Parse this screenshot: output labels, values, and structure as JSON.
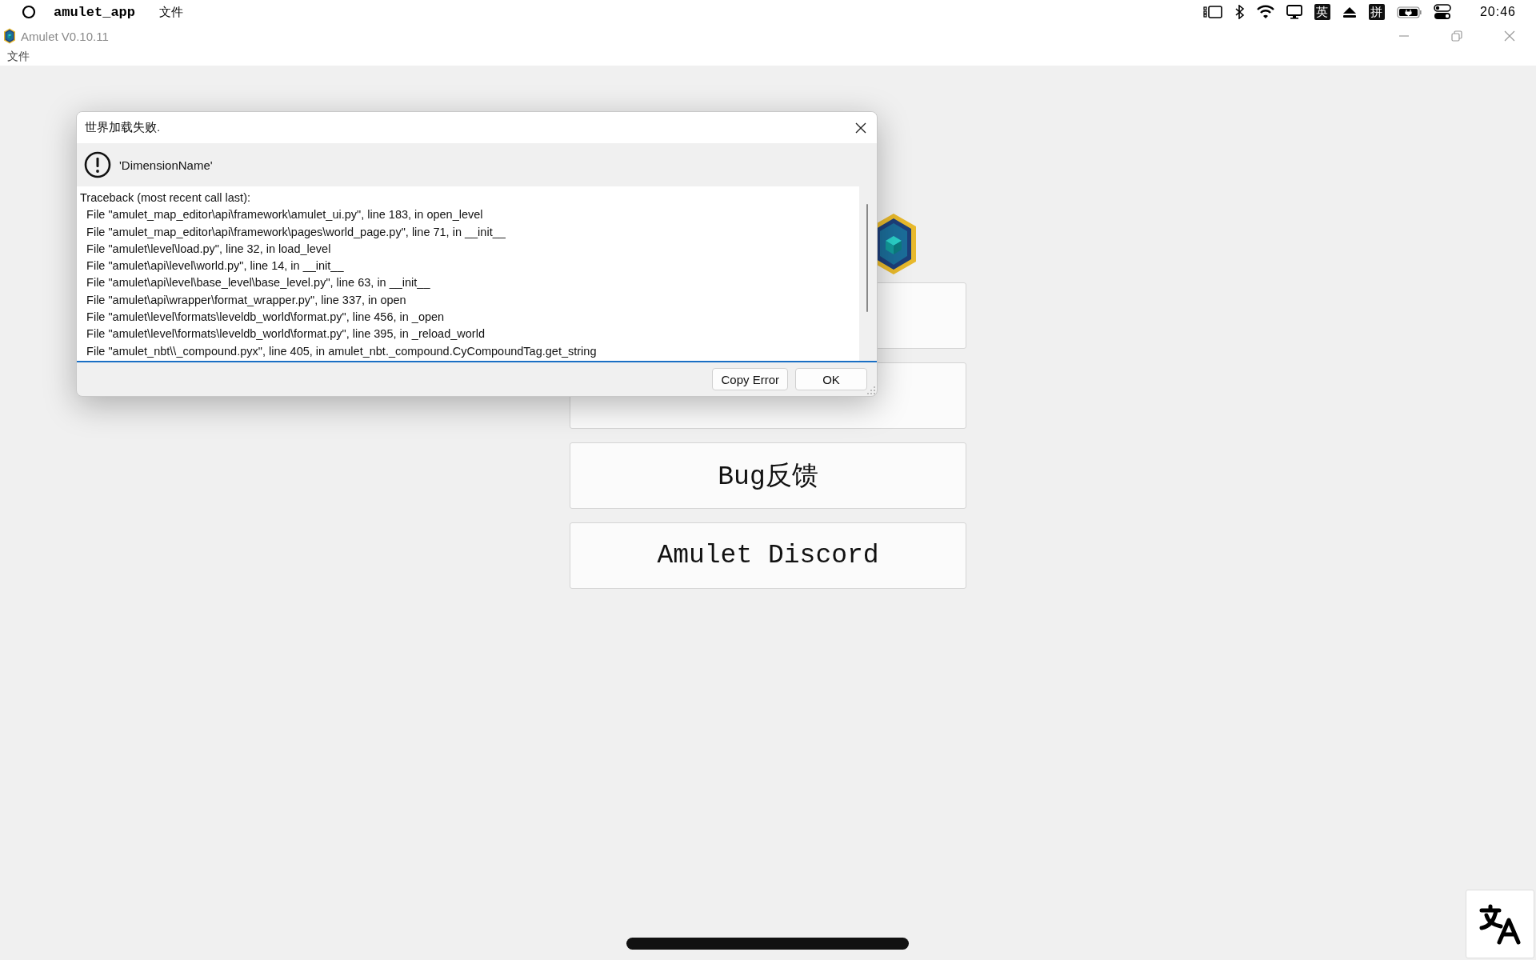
{
  "system_bar": {
    "app_name": "amulet_app",
    "menu": "文件",
    "input_modes": [
      "英",
      "拼"
    ],
    "time": "20:46"
  },
  "window": {
    "title": "Amulet V0.10.11",
    "menu": [
      "文件"
    ]
  },
  "home_buttons": [
    {
      "label": "Bug反馈"
    },
    {
      "label": "Amulet Discord"
    }
  ],
  "dialog": {
    "title": "世界加载失败.",
    "message": "'DimensionName'",
    "traceback": [
      "Traceback (most recent call last):",
      "  File \"amulet_map_editor\\api\\framework\\amulet_ui.py\", line 183, in open_level",
      "  File \"amulet_map_editor\\api\\framework\\pages\\world_page.py\", line 71, in __init__",
      "  File \"amulet\\level\\load.py\", line 32, in load_level",
      "  File \"amulet\\api\\level\\world.py\", line 14, in __init__",
      "  File \"amulet\\api\\level\\base_level\\base_level.py\", line 63, in __init__",
      "  File \"amulet\\api\\wrapper\\format_wrapper.py\", line 337, in open",
      "  File \"amulet\\level\\formats\\leveldb_world\\format.py\", line 456, in _open",
      "  File \"amulet\\level\\formats\\leveldb_world\\format.py\", line 395, in _reload_world",
      "  File \"amulet_nbt\\\\_compound.pyx\", line 405, in amulet_nbt._compound.CyCompoundTag.get_string"
    ],
    "buttons": [
      "Copy Error",
      "OK"
    ]
  }
}
